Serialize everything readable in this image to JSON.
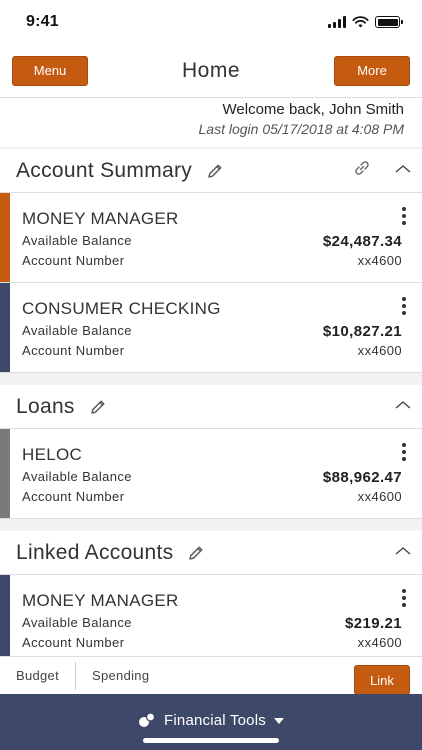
{
  "status": {
    "time": "9:41"
  },
  "header": {
    "menu_label": "Menu",
    "title": "Home",
    "more_label": "More"
  },
  "welcome": {
    "greeting": "Welcome back, John Smith",
    "last_login": "Last login 05/17/2018 at 4:08 PM"
  },
  "sections": {
    "summary": {
      "title": "Account Summary",
      "accounts": [
        {
          "name": "MONEY MANAGER",
          "balance_label": "Available Balance",
          "balance": "$24,487.34",
          "number_label": "Account Number",
          "number": "xx4600",
          "accent": "#c55a11"
        },
        {
          "name": "CONSUMER CHECKING",
          "balance_label": "Available Balance",
          "balance": "$10,827.21",
          "number_label": "Account Number",
          "number": "xx4600",
          "accent": "#3e4868"
        }
      ]
    },
    "loans": {
      "title": "Loans",
      "accounts": [
        {
          "name": "HELOC",
          "balance_label": "Available Balance",
          "balance": "$88,962.47",
          "number_label": "Account Number",
          "number": "xx4600",
          "accent": "#7a7a7a"
        }
      ]
    },
    "linked": {
      "title": "Linked Accounts",
      "accounts": [
        {
          "name": "MONEY MANAGER",
          "balance_label": "Available Balance",
          "balance": "$219.21",
          "number_label": "Account Number",
          "number": "xx4600",
          "accent": "#3e4868"
        }
      ]
    }
  },
  "tools": {
    "tabs": [
      "Budget",
      "Spending"
    ],
    "link_label": "Link"
  },
  "bottom": {
    "label": "Financial Tools"
  },
  "colors": {
    "brand_orange": "#c55a11",
    "navy": "#3e4868"
  },
  "icons": {
    "pencil": "pencil-icon",
    "link": "link-icon",
    "collapse": "chevron-up-icon",
    "more": "kebab-icon",
    "tools": "coins-icon"
  }
}
